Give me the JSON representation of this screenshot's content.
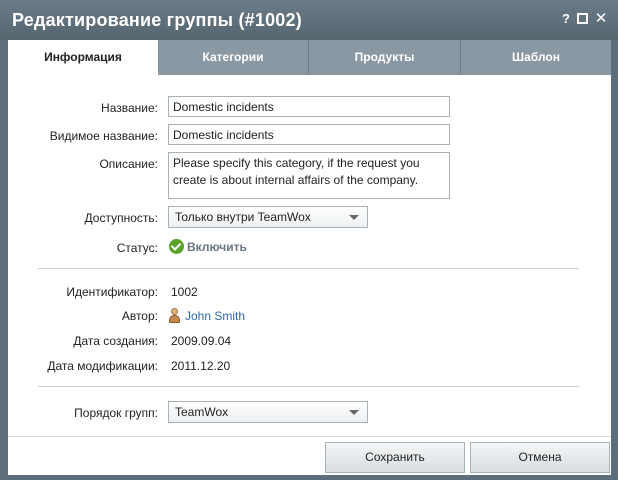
{
  "window": {
    "title": "Редактирование группы (#1002)",
    "help_glyph": "?",
    "close_glyph": "✕"
  },
  "tabs": [
    {
      "label": "Информация",
      "active": true
    },
    {
      "label": "Категории",
      "active": false
    },
    {
      "label": "Продукты",
      "active": false
    },
    {
      "label": "Шаблон",
      "active": false
    }
  ],
  "form": {
    "name": {
      "label": "Название:",
      "value": "Domestic incidents"
    },
    "visible_name": {
      "label": "Видимое название:",
      "value": "Domestic incidents"
    },
    "description": {
      "label": "Описание:",
      "value": "Please specify this category, if the request you create is about internal affairs of the company."
    },
    "availability": {
      "label": "Доступность:",
      "value": "Только внутри TeamWox"
    },
    "status": {
      "label": "Статус:",
      "value": "Включить"
    }
  },
  "info": {
    "id": {
      "label": "Идентификатор:",
      "value": "1002"
    },
    "author": {
      "label": "Автор:",
      "value": "John Smith"
    },
    "created": {
      "label": "Дата создания:",
      "value": "2009.09.04"
    },
    "modified": {
      "label": "Дата модификации:",
      "value": "2011.12.20"
    }
  },
  "order": {
    "label": "Порядок групп:",
    "value": "TeamWox"
  },
  "buttons": {
    "save": "Сохранить",
    "cancel": "Отмена"
  },
  "colors": {
    "titlebar": "#5d6d7b",
    "tab_inactive": "#8a98a4",
    "link": "#2b6ab0",
    "status_green": "#5aa12a"
  }
}
